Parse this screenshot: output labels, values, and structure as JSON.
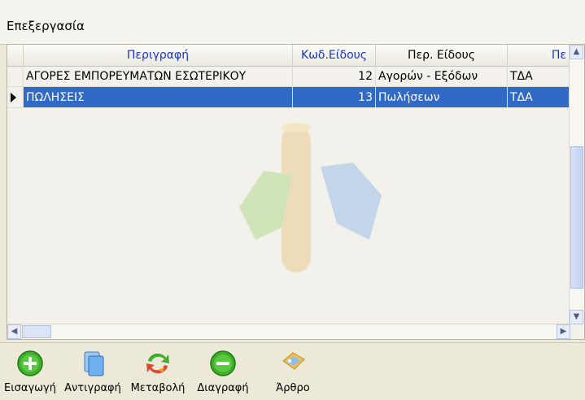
{
  "group": {
    "title": "Επεξεργασία"
  },
  "grid": {
    "columns": [
      "Περιγραφή",
      "Κωδ.Είδους",
      "Περ. Είδους",
      "Πε"
    ],
    "rows": [
      {
        "desc": "ΑΓΟΡΕΣ ΕΜΠΟΡΕΥΜΑΤΩΝ ΕΣΩΤΕΡΙΚΟΥ",
        "code": "12",
        "type": "Αγορών - Εξόδων",
        "extra": "ΤΔΑ",
        "selected": false
      },
      {
        "desc": "ΠΩΛΗΣΕΙΣ",
        "code": "13",
        "type": "Πωλήσεων",
        "extra": "ΤΔΑ",
        "selected": true
      }
    ],
    "header_color": "#1c36c8",
    "selection_color": "#3169c6"
  },
  "toolbar": {
    "insert": "Εισαγωγή",
    "copy": "Αντιγραφή",
    "edit": "Μεταβολή",
    "delete": "Διαγραφή",
    "entry": "Άρθρο"
  },
  "icons": [
    "plus-circle-icon",
    "copy-icon",
    "refresh-icon",
    "minus-circle-icon",
    "document-tag-icon"
  ]
}
